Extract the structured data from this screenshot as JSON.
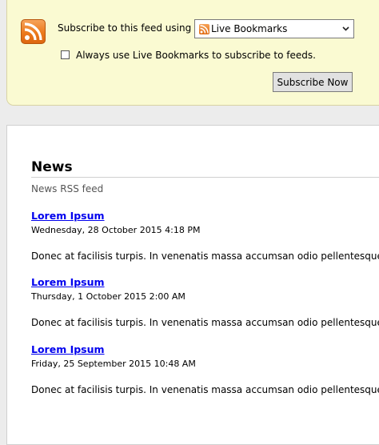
{
  "subscribe": {
    "label": "Subscribe to this feed using",
    "reader_option": "Live Bookmarks",
    "always_use_label": "Always use Live Bookmarks to subscribe to feeds.",
    "always_use_checked": false,
    "button_label": "Subscribe Now"
  },
  "feed": {
    "title": "News",
    "subtitle": "News RSS feed",
    "items": [
      {
        "title": "Lorem Ipsum",
        "date": "Wednesday, 28 October 2015 4:18 PM",
        "description": "Donec at facilisis turpis. In venenatis massa accumsan odio pellentesque."
      },
      {
        "title": "Lorem Ipsum",
        "date": "Thursday, 1 October 2015 2:00 AM",
        "description": "Donec at facilisis turpis. In venenatis massa accumsan odio pellentesque."
      },
      {
        "title": "Lorem Ipsum",
        "date": "Friday, 25 September 2015 10:48 AM",
        "description": "Donec at facilisis turpis. In venenatis massa accumsan odio pellentesque."
      }
    ]
  },
  "colors": {
    "subscribe_box_bg": "#fafad2",
    "link": "#0000ee",
    "rss_orange": "#ec7a1c"
  },
  "icons": [
    "rss-feed-icon",
    "rss-mini-icon",
    "chevron-down-icon"
  ]
}
